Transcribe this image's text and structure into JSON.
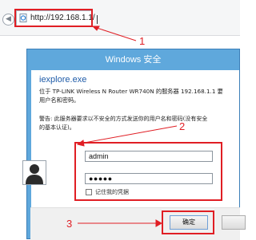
{
  "browser": {
    "url": "http://192.168.1.1/",
    "back_icon": "back-arrow-icon",
    "page_icon": "ie-page-icon"
  },
  "dialog": {
    "title": "Windows 安全",
    "app_name": "iexplore.exe",
    "message_line1": "位于 TP-LINK Wireless N Router WR740N 的服务器 192.168.1.1 要",
    "message_line2": "用户名和密码。",
    "warning_line1": "警告: 此服务器要求以不安全的方式发送你的用户名和密码(没有安全",
    "warning_line2": "的基本认证)。",
    "username_value": "admin",
    "password_mask": "●●●●●",
    "remember_label": "记住我的凭据",
    "ok_label": "确定",
    "avatar_icon": "user-avatar-icon"
  },
  "annotations": {
    "num1": "1",
    "num2": "2",
    "num3": "3",
    "color": "#e01e24"
  },
  "colors": {
    "dialog_frame": "#5fa8dc",
    "link_blue": "#1e5ba8"
  }
}
